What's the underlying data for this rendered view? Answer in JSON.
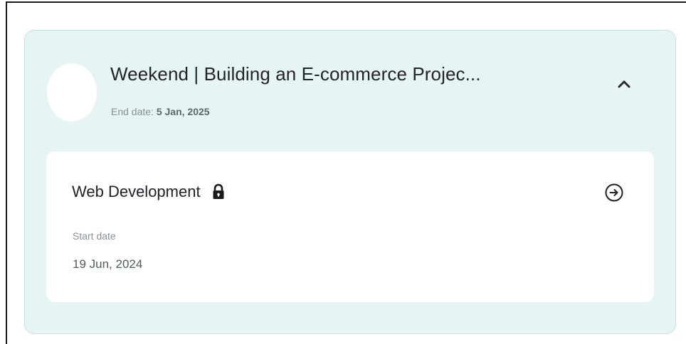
{
  "course": {
    "title": "Weekend | Building an E-commerce Projec...",
    "end_label": "End date:",
    "end_value": "5 Jan, 2025",
    "collapse_icon": "chevron-up-icon"
  },
  "module": {
    "name": "Web Development",
    "lock_icon": "lock-icon",
    "open_icon": "arrow-right-circle-icon",
    "start_label": "Start date",
    "start_value": "19 Jun, 2024"
  },
  "colors": {
    "card_background": "#e6f4f3",
    "inner_card": "#ffffff",
    "title_text": "#222428",
    "muted_text": "#8a8f95"
  }
}
